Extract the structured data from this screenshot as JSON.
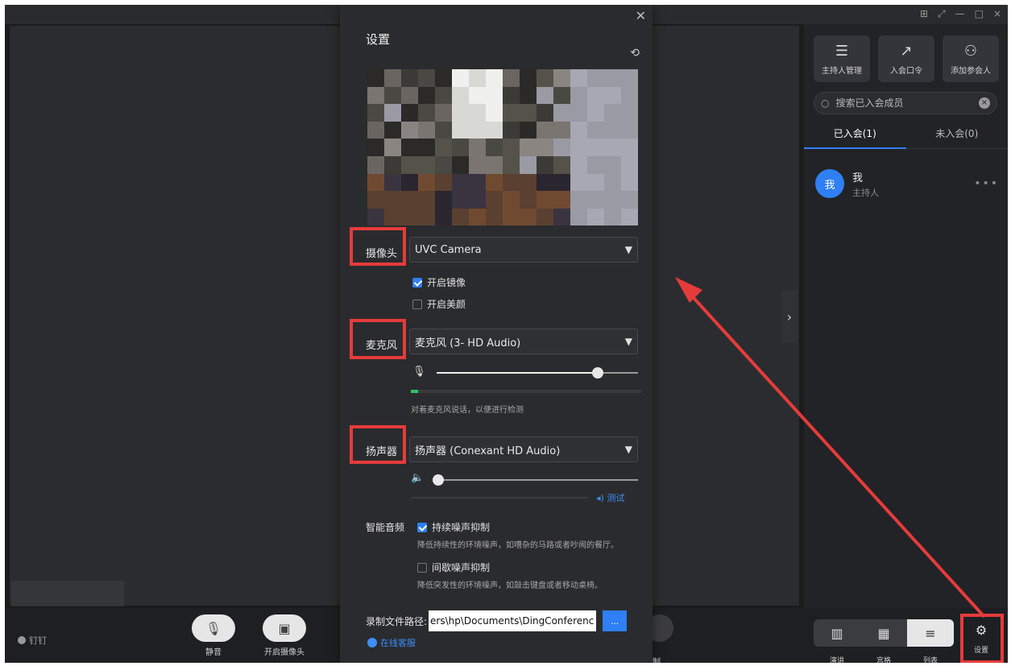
{
  "window": {
    "controls": [
      "⊞",
      "⤢",
      "—",
      "□",
      "×"
    ]
  },
  "right_panel": {
    "buttons": [
      {
        "icon": "sliders-icon",
        "label": "主持人管理"
      },
      {
        "icon": "share-icon",
        "label": "入会口令"
      },
      {
        "icon": "add-user-icon",
        "label": "添加参会人"
      }
    ],
    "search_placeholder": "搜索已入会成员",
    "tabs": [
      {
        "label": "已入会(1)",
        "active": true
      },
      {
        "label": "未入会(0)",
        "active": false
      }
    ],
    "members": [
      {
        "avatar_text": "我",
        "name": "我",
        "role": "主持人",
        "avatar_color": "#2f7ff5"
      }
    ]
  },
  "bottom_bar": {
    "brand": "钉钉",
    "mute_label": "静音",
    "camera_label": "开启摄像头",
    "record_fragment_label": "制",
    "layouts": [
      {
        "label": "演讲"
      },
      {
        "label": "宫格"
      },
      {
        "label": "列表",
        "selected": true
      }
    ],
    "settings_label": "设置"
  },
  "settings_dialog": {
    "title": "设置",
    "camera": {
      "label": "摄像头",
      "device": "UVC Camera",
      "mirror_label": "开启镜像",
      "mirror_checked": true,
      "beauty_label": "开启美颜",
      "beauty_checked": false
    },
    "microphone": {
      "label": "麦克风",
      "device": "麦克风 (3- HD Audio)",
      "volume": 0.8,
      "level": 0.03,
      "hint": "对着麦克风说话，以便进行检测"
    },
    "speaker": {
      "label": "扬声器",
      "device": "扬声器 (Conexant HD Audio)",
      "volume": 0.0,
      "test_label": "测试"
    },
    "smart_audio": {
      "label": "智能音频",
      "continuous_label": "持续噪声抑制",
      "continuous_checked": true,
      "continuous_hint": "降低持续性的环境噪声，如嘈杂的马路或者吵闹的餐厅。",
      "intermittent_label": "间歇噪声抑制",
      "intermittent_checked": false,
      "intermittent_hint": "降低突发性的环境噪声，如敲击键盘或者移动桌椅。"
    },
    "record_path": {
      "label": "录制文件路径:",
      "value": "ers\\hp\\Documents\\DingConference",
      "browse_label": "..."
    },
    "online_service": "在线客服"
  },
  "colors": {
    "accent": "#2f7ff5",
    "highlight": "#e63b3b",
    "meter": "#30c06a"
  }
}
